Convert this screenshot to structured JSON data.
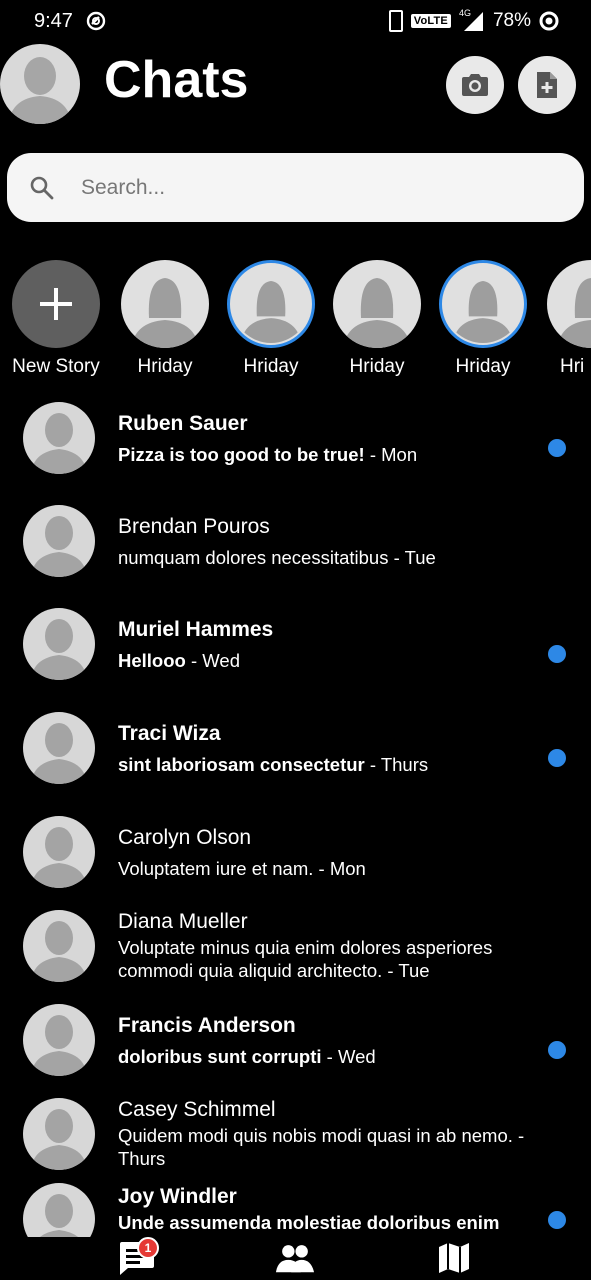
{
  "status_bar": {
    "time": "9:47",
    "network_badge": "VoLTE",
    "signal_label": "4G",
    "battery": "78%"
  },
  "header": {
    "title": "Chats",
    "camera_icon": "camera-icon",
    "compose_icon": "compose-icon"
  },
  "search": {
    "placeholder": "Search..."
  },
  "stories": [
    {
      "label": "New Story",
      "type": "new"
    },
    {
      "label": "Hriday",
      "ring": false
    },
    {
      "label": "Hriday",
      "ring": true
    },
    {
      "label": "Hriday",
      "ring": false
    },
    {
      "label": "Hriday",
      "ring": true
    },
    {
      "label": "Hri",
      "ring": false
    }
  ],
  "chats": [
    {
      "name": "Ruben Sauer",
      "message": "Pizza is too good to be true!",
      "time": "- Mon",
      "unread": true
    },
    {
      "name": "Brendan Pouros",
      "message": "numquam dolores necessitatibus",
      "time": "- Tue",
      "unread": false
    },
    {
      "name": "Muriel Hammes",
      "message": "Hellooo",
      "time": "- Wed",
      "unread": true
    },
    {
      "name": "Traci Wiza",
      "message": "sint laboriosam consectetur",
      "time": "- Thurs",
      "unread": true
    },
    {
      "name": "Carolyn Olson",
      "message": "Voluptatem iure et nam.",
      "time": "- Mon",
      "unread": false
    },
    {
      "name": "Diana Mueller",
      "message": "Voluptate minus quia enim dolores asperiores commodi quia aliquid architecto.",
      "time": "- Tue",
      "unread": false
    },
    {
      "name": "Francis Anderson",
      "message": "doloribus sunt corrupti",
      "time": "- Wed",
      "unread": true
    },
    {
      "name": "Casey Schimmel",
      "message": "Quidem modi quis nobis modi quasi in ab nemo.",
      "time": "- Thurs",
      "unread": false
    },
    {
      "name": "Joy Windler",
      "message": "Unde assumenda molestiae doloribus enim",
      "time": "",
      "unread": true
    }
  ],
  "bottom_nav": {
    "chats_badge": "1",
    "items": [
      "chats-icon",
      "people-icon",
      "map-icon"
    ]
  },
  "colors": {
    "accent": "#2d88e6",
    "background": "#000000",
    "badge": "#e53935"
  }
}
